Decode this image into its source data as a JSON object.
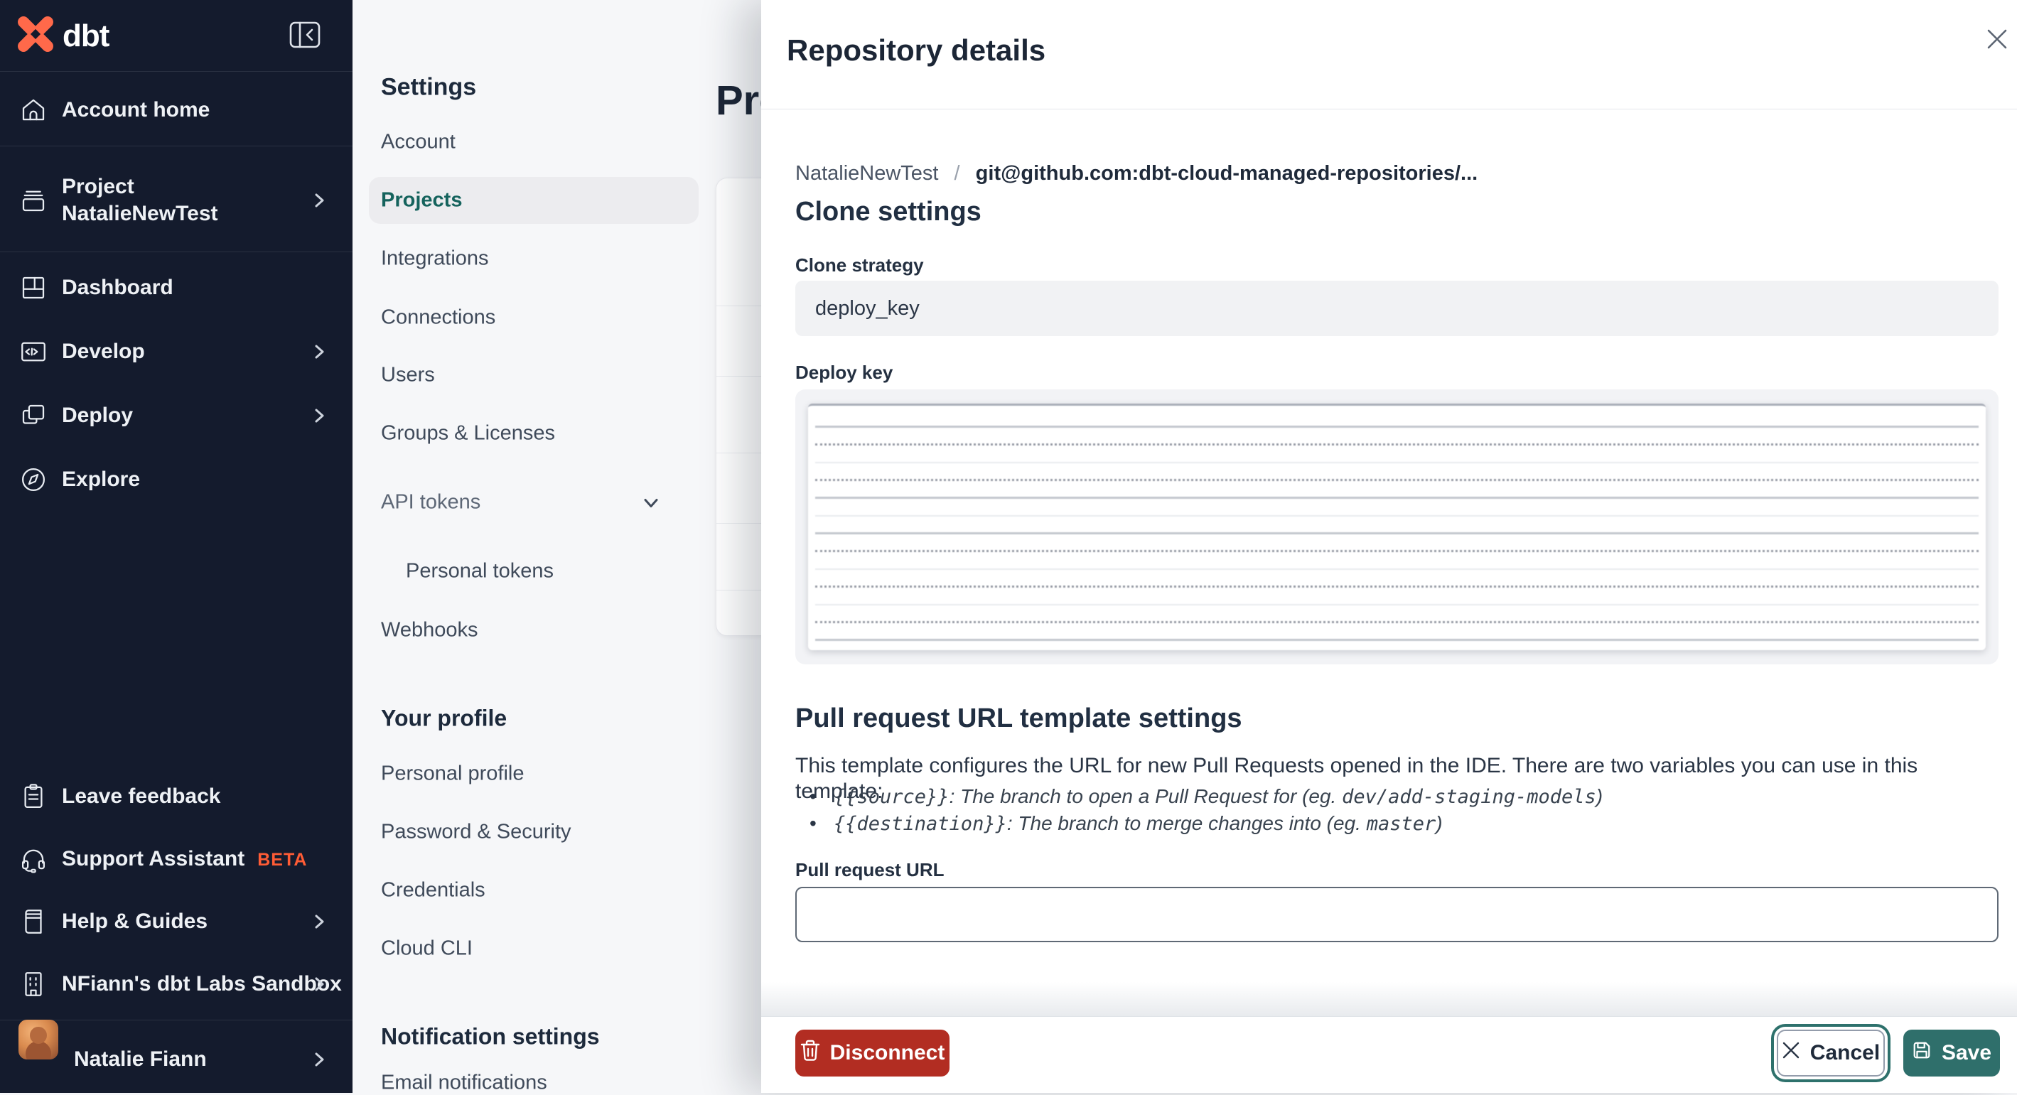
{
  "sidebar": {
    "logo_text": "dbt",
    "items": [
      {
        "label": "Account home"
      },
      {
        "line1": "Project",
        "line2": "NatalieNewTest"
      },
      {
        "label": "Dashboard"
      },
      {
        "label": "Develop"
      },
      {
        "label": "Deploy"
      },
      {
        "label": "Explore"
      }
    ],
    "bottom_items": [
      {
        "label": "Leave feedback"
      },
      {
        "label": "Support Assistant",
        "badge": "BETA"
      },
      {
        "label": "Help & Guides"
      },
      {
        "label": "NFiann's dbt Labs Sandbox"
      }
    ],
    "user": {
      "name": "Natalie Fiann"
    }
  },
  "settings_nav": {
    "title": "Settings",
    "items": [
      "Account",
      "Projects",
      "Integrations",
      "Connections",
      "Users",
      "Groups & Licenses"
    ],
    "api_tokens_label": "API tokens",
    "sub_items": [
      "Personal tokens"
    ],
    "webhooks_label": "Webhooks",
    "profile_heading": "Your profile",
    "profile_items": [
      "Personal profile",
      "Password & Security",
      "Credentials",
      "Cloud CLI"
    ],
    "notifications_heading": "Notification settings",
    "notification_items": [
      "Email notifications"
    ]
  },
  "main": {
    "title": "Projects"
  },
  "drawer": {
    "title": "Repository details",
    "breadcrumb": {
      "project": "NatalieNewTest",
      "separator": "/",
      "repo": "git@github.com:dbt-cloud-managed-repositories/..."
    },
    "clone_settings": {
      "heading": "Clone settings",
      "strategy_label": "Clone strategy",
      "strategy_value": "deploy_key",
      "deploy_key_label": "Deploy key"
    },
    "pr_template": {
      "heading": "Pull request URL template settings",
      "description": "This template configures the URL for new Pull Requests opened in the IDE. There are two variables you can use in this template:",
      "bullets": [
        {
          "code": "{{source}}",
          "sep": ": ",
          "desc": "The branch to open a Pull Request for (eg. ",
          "example": "dev/add-staging-models",
          "close": ")"
        },
        {
          "code": "{{destination}}",
          "sep": ": ",
          "desc": "The branch to merge changes into (eg. ",
          "example": "master",
          "close": ")"
        }
      ],
      "url_label": "Pull request URL",
      "url_value": ""
    },
    "footer": {
      "disconnect": "Disconnect",
      "cancel": "Cancel",
      "save": "Save"
    },
    "colors": {
      "accent_teal": "#2f6f6b",
      "danger_red": "#b22d22",
      "brand_orange": "#ff5c35",
      "sidebar_bg": "#141b2d"
    }
  }
}
